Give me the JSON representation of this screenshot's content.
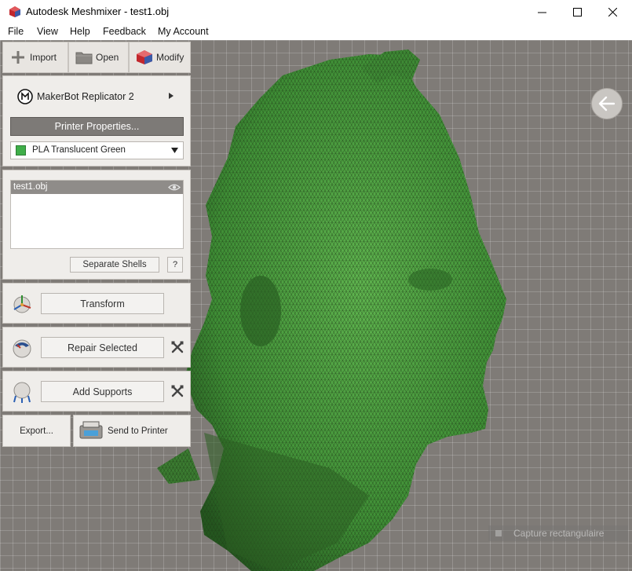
{
  "window": {
    "title": "Autodesk Meshmixer - test1.obj",
    "controls": [
      "minimize-icon",
      "maximize-icon",
      "close-icon"
    ]
  },
  "menu": {
    "items": [
      "File",
      "View",
      "Help",
      "Feedback",
      "My Account"
    ]
  },
  "toolbar": {
    "import_label": "Import",
    "open_label": "Open",
    "modify_label": "Modify"
  },
  "printer": {
    "name": "MakerBot Replicator 2",
    "properties_label": "Printer Properties...",
    "material": "PLA Translucent Green",
    "material_color": "#3fae49"
  },
  "objects": {
    "items": [
      {
        "name": "test1.obj",
        "visible": true
      }
    ],
    "separate_shells_label": "Separate Shells",
    "help_label": "?"
  },
  "actions": {
    "transform_label": "Transform",
    "repair_label": "Repair Selected",
    "supports_label": "Add Supports",
    "export_label": "Export...",
    "send_label": "Send to Printer"
  },
  "overlay": {
    "capture_label": "Capture rectangulaire"
  },
  "colors": {
    "mesh": "#4a9a3e",
    "viewport": "#7f7b77",
    "panel": "#efedea"
  }
}
